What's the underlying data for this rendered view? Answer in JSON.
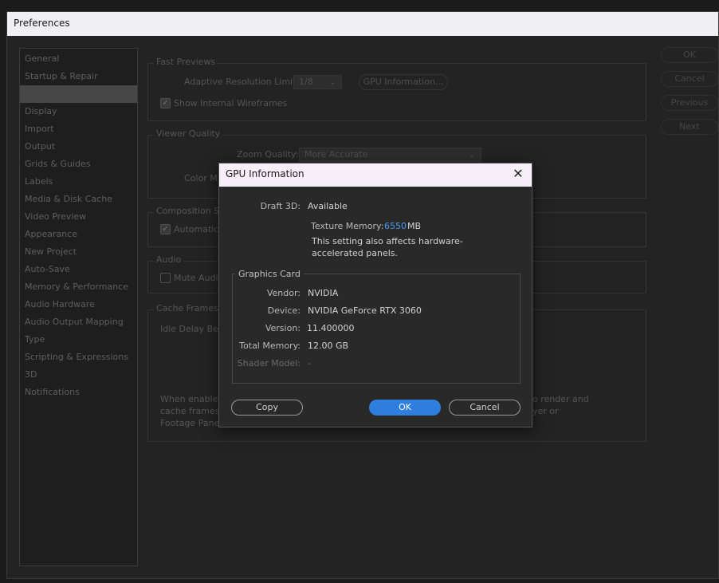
{
  "window": {
    "title": "Preferences"
  },
  "sidebar": {
    "items": [
      {
        "label": "General"
      },
      {
        "label": "Startup & Repair"
      },
      {
        "label": ""
      },
      {
        "label": "Display"
      },
      {
        "label": "Import"
      },
      {
        "label": "Output"
      },
      {
        "label": "Grids & Guides"
      },
      {
        "label": "Labels"
      },
      {
        "label": "Media & Disk Cache"
      },
      {
        "label": "Video Preview"
      },
      {
        "label": "Appearance"
      },
      {
        "label": "New Project"
      },
      {
        "label": "Auto-Save"
      },
      {
        "label": "Memory & Performance"
      },
      {
        "label": "Audio Hardware"
      },
      {
        "label": "Audio Output Mapping"
      },
      {
        "label": "Type"
      },
      {
        "label": "Scripting & Expressions"
      },
      {
        "label": "3D"
      },
      {
        "label": "Notifications"
      }
    ]
  },
  "side_buttons": {
    "ok": "OK",
    "cancel": "Cancel",
    "previous": "Previous",
    "next": "Next"
  },
  "fast_previews": {
    "title": "Fast Previews",
    "adaptive_label": "Adaptive Resolution Limit:",
    "adaptive_value": "1/8",
    "gpu_info_button": "GPU Information...",
    "wireframes_label": "Show Internal Wireframes"
  },
  "viewer_quality": {
    "title": "Viewer Quality",
    "zoom_label": "Zoom Quality:",
    "zoom_value": "More Accurate",
    "color_label": "Color M"
  },
  "composition": {
    "title": "Composition Sw",
    "auto_label": "Automatica"
  },
  "audio": {
    "title": "Audio",
    "mute_label": "Mute Audio"
  },
  "cache": {
    "title": "Cache Frames W",
    "idle_label": "Idle Delay Befo",
    "note_left_1": "When enabled",
    "note_left_2": "cache frames i",
    "note_left_3": "Footage Panel",
    "note_right_1": "o render and",
    "note_right_2": "yer or"
  },
  "gpu_dialog": {
    "title": "GPU Information",
    "draft3d_label": "Draft 3D:",
    "draft3d_value": "Available",
    "texture_label": "Texture Memory:",
    "texture_value": "6550",
    "texture_unit": "MB",
    "note": "This setting also affects hardware-accelerated panels.",
    "graphics_card_title": "Graphics Card",
    "vendor_label": "Vendor:",
    "vendor_value": "NVIDIA",
    "device_label": "Device:",
    "device_value": "NVIDIA GeForce RTX 3060",
    "version_label": "Version:",
    "version_value": "11.400000",
    "total_memory_label": "Total Memory:",
    "total_memory_value": "12.00 GB",
    "shader_label": "Shader Model:",
    "shader_value": "-",
    "copy_button": "Copy",
    "ok_button": "OK",
    "cancel_button": "Cancel",
    "accent_color": "#2e7fe0"
  }
}
